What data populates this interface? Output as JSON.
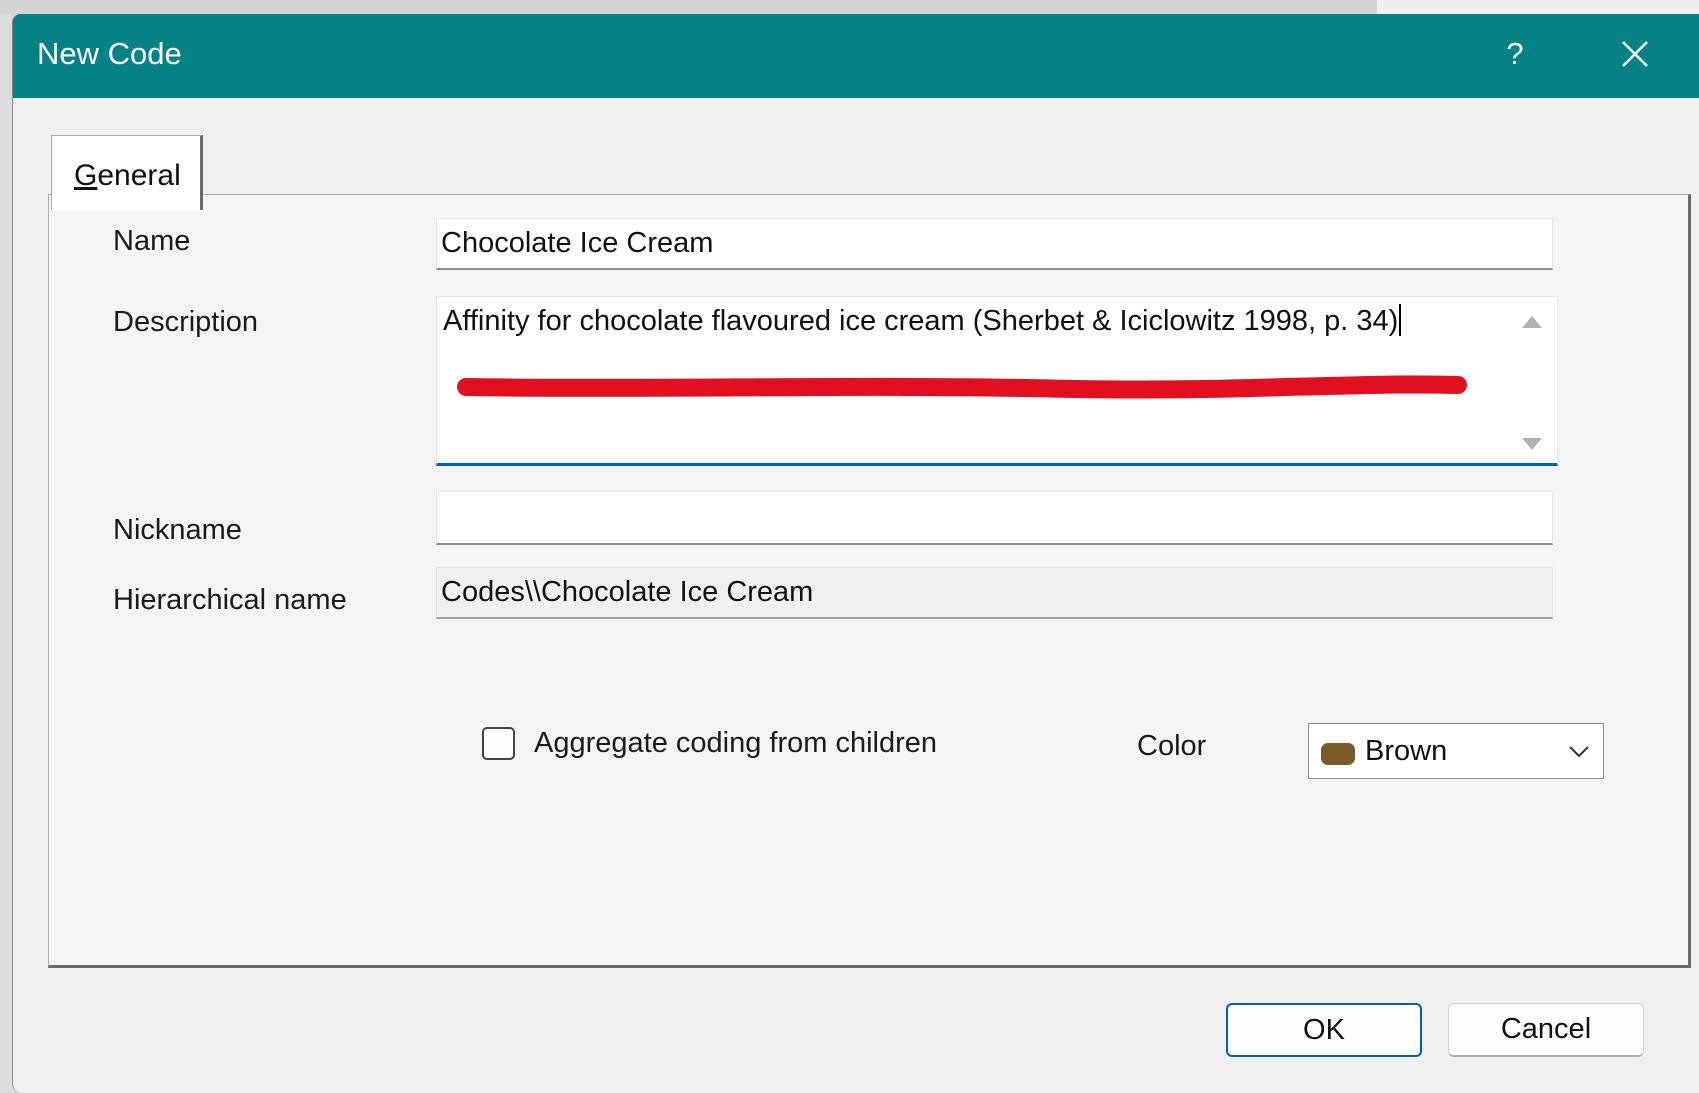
{
  "window": {
    "title": "New Code",
    "help_label": "?",
    "close_icon": "close-icon"
  },
  "tabs": [
    {
      "label_mnemonic": "G",
      "label_rest": "eneral",
      "selected": true
    }
  ],
  "form": {
    "name": {
      "label": "Name",
      "value": "Chocolate Ice Cream"
    },
    "description": {
      "label": "Description",
      "value": "Affinity for chocolate flavoured ice cream (Sherbet & Iciclowitz 1998, p. 34)"
    },
    "nickname": {
      "label": "Nickname",
      "value": ""
    },
    "hierarchical_name": {
      "label": "Hierarchical name",
      "value": "Codes\\\\Chocolate Ice Cream"
    },
    "aggregate": {
      "label": "Aggregate coding from children",
      "checked": false
    },
    "color": {
      "label": "Color",
      "value": "Brown",
      "swatch": "#7a5b2a"
    }
  },
  "buttons": {
    "ok": "OK",
    "cancel": "Cancel"
  },
  "colors": {
    "titlebar": "#068286",
    "focus_accent": "#005fb8",
    "annotation": "#e01020"
  }
}
